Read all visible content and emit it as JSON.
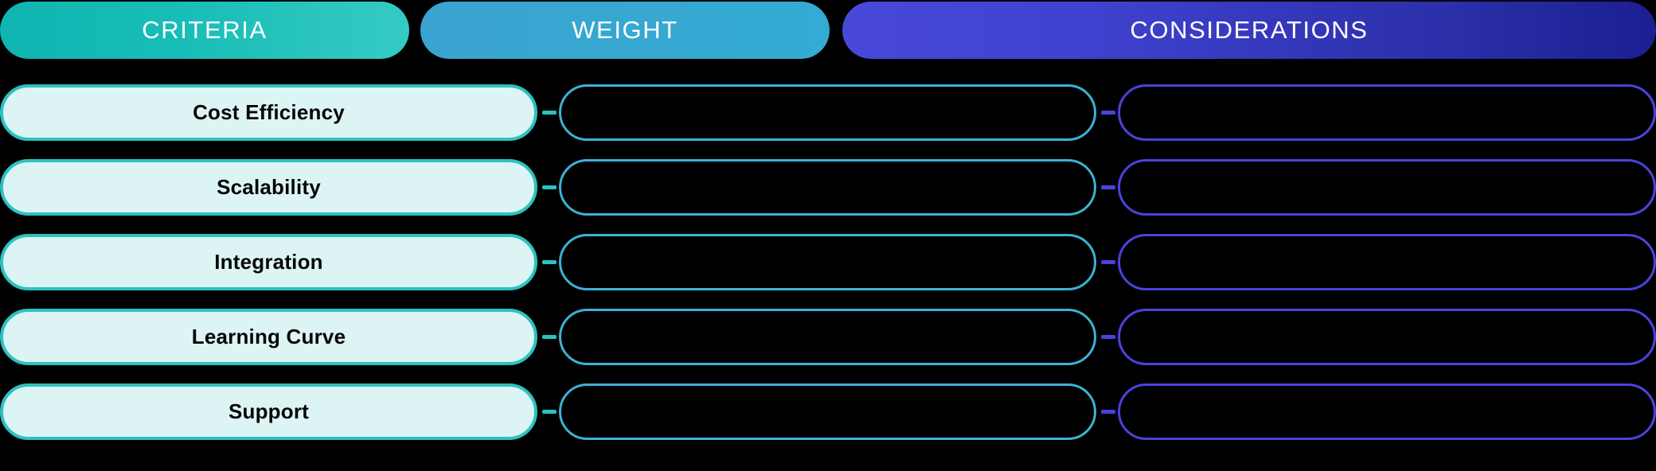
{
  "theme": {
    "background": "#000000",
    "criteria_accent": "#19bdb7",
    "weight_accent": "#36a8d1",
    "considerations_accent": "#3f42cf",
    "criteria_cell_fill": "#ddf4f4",
    "criteria_cell_border": "#2cc2c0",
    "weight_cell_border": "#3bb2d4",
    "considerations_cell_border": "#4b42e0",
    "header_text_color": "#ffffff",
    "criteria_text_color": "#050505"
  },
  "headers": [
    {
      "id": "criteria",
      "label": "CRITERIA"
    },
    {
      "id": "weight",
      "label": "WEIGHT"
    },
    {
      "id": "considerations",
      "label": "CONSIDERATIONS"
    }
  ],
  "rows": [
    {
      "criteria": "Cost Efficiency",
      "weight": "",
      "considerations": ""
    },
    {
      "criteria": "Scalability",
      "weight": "",
      "considerations": ""
    },
    {
      "criteria": "Integration",
      "weight": "",
      "considerations": ""
    },
    {
      "criteria": "Learning Curve",
      "weight": "",
      "considerations": ""
    },
    {
      "criteria": "Support",
      "weight": "",
      "considerations": ""
    }
  ]
}
